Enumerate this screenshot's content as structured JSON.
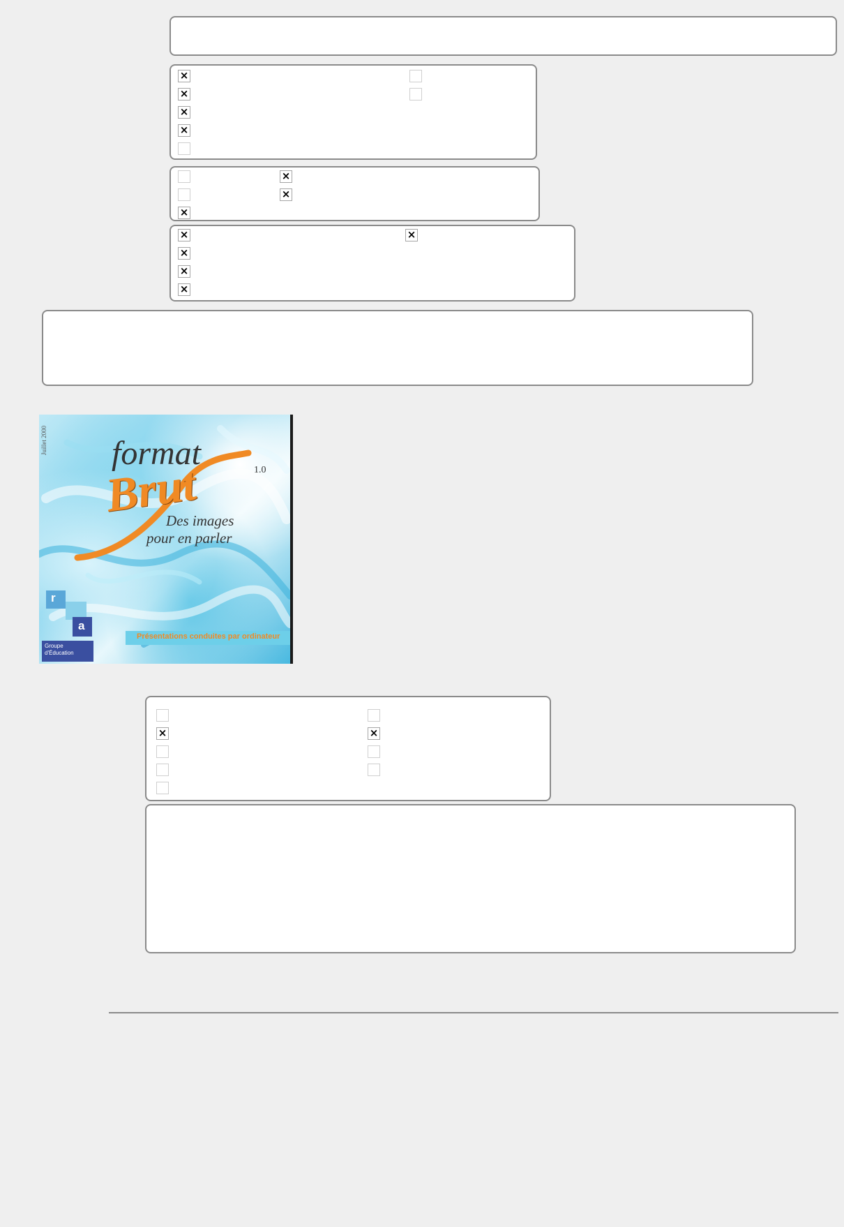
{
  "cover": {
    "side_text": "Juillet 2000",
    "word_format": "format",
    "word_brut": "Brut",
    "version": "1.0",
    "tagline_line1": "Des images",
    "tagline_line2": "pour en parler",
    "banner": "Présentations conduites par ordinateur",
    "puzzle_r": "r",
    "puzzle_a": "a",
    "publisher_line1": "Groupe",
    "publisher_line2": "d'Éducation"
  },
  "colors": {
    "orange": "#f08a24",
    "banner_bg": "#6dcfe9",
    "puzzle": "#3a4fa0"
  },
  "checkbox_groups": {
    "group1": [
      true,
      true,
      true,
      true,
      false,
      false,
      false
    ],
    "group2": [
      false,
      false,
      true,
      true,
      true
    ],
    "group3": [
      true,
      true,
      true,
      true,
      true
    ],
    "group4": [
      false,
      true,
      false,
      false,
      false,
      false,
      true,
      false,
      false
    ]
  }
}
